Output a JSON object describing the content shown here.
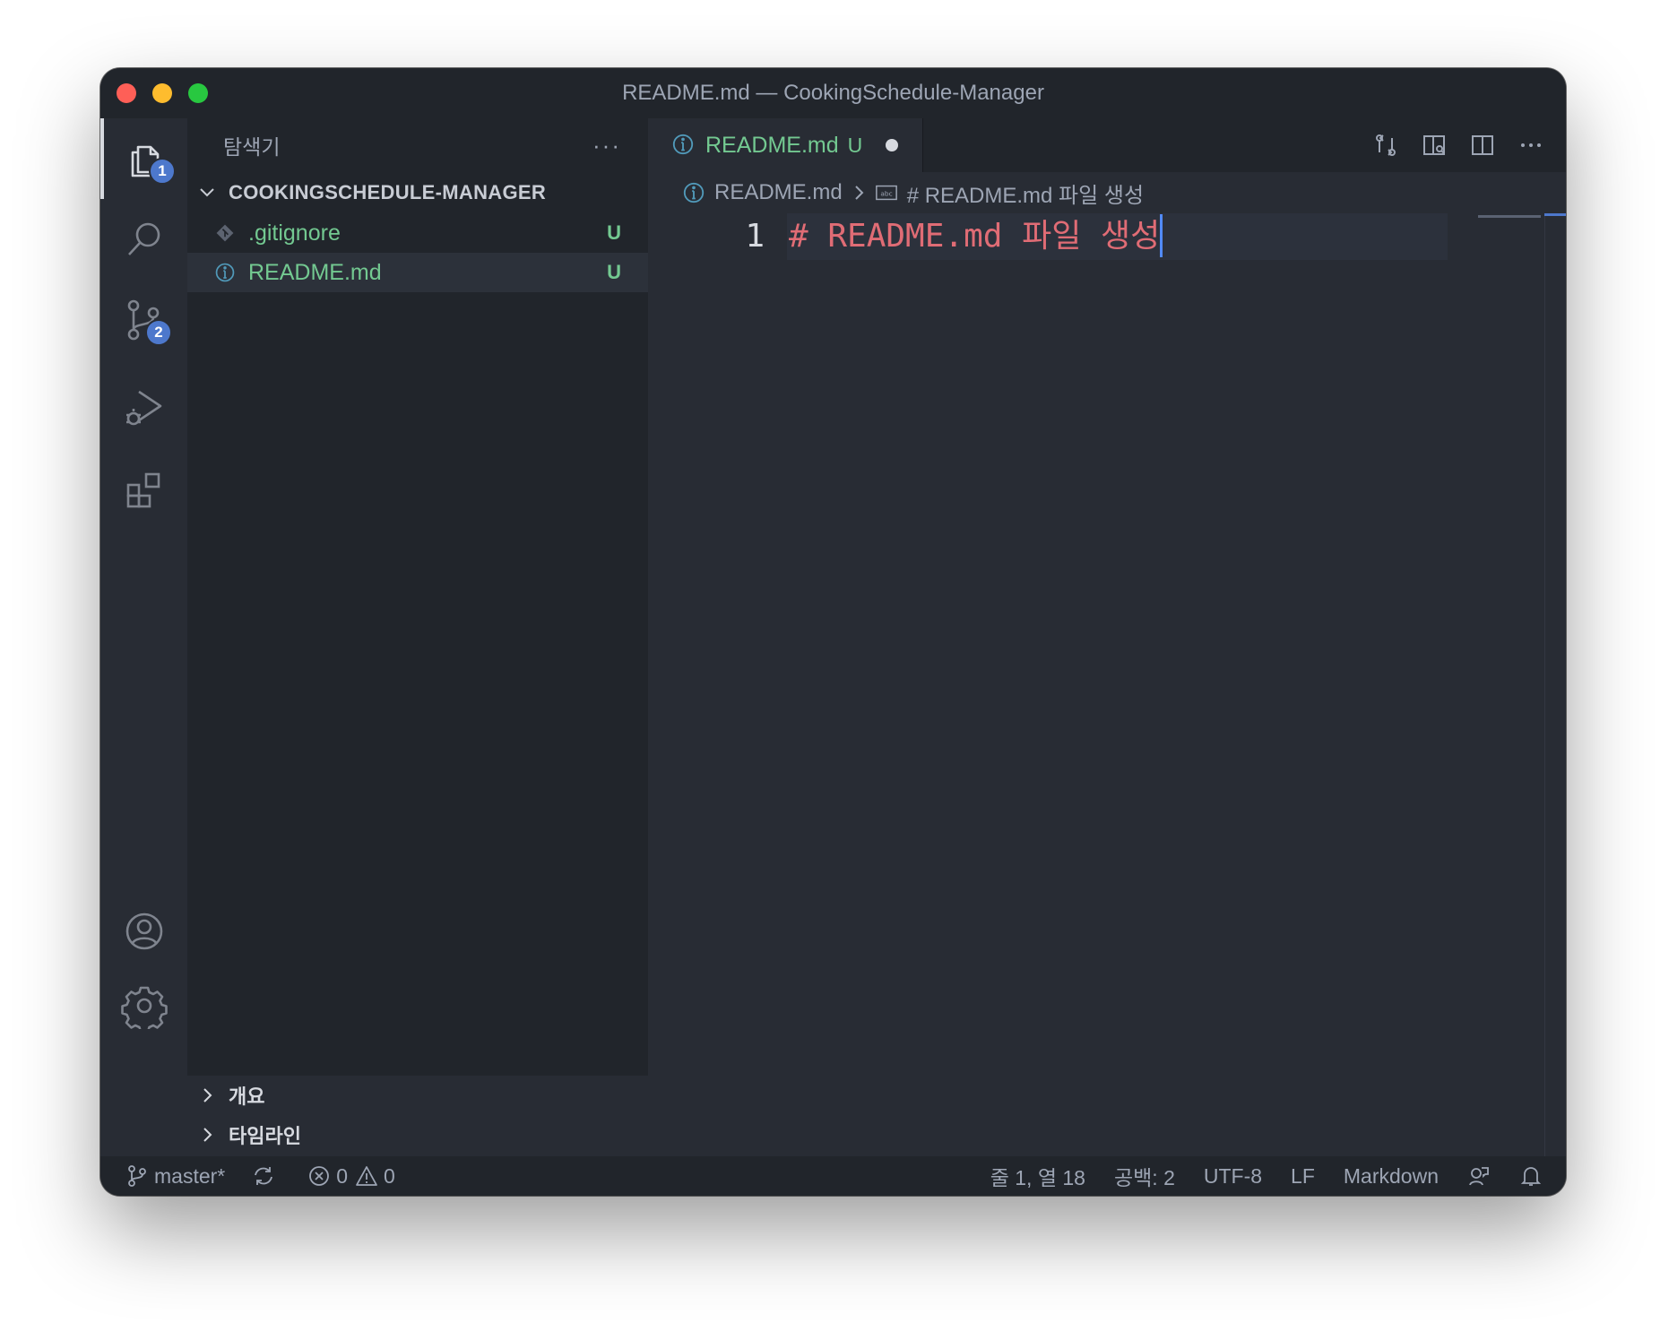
{
  "window": {
    "title": "README.md — CookingSchedule-Manager"
  },
  "activity_bar": {
    "explorer_badge": "1",
    "source_control_badge": "2"
  },
  "sidebar": {
    "header": "탐색기",
    "more": "···",
    "folder_name": "COOKINGSCHEDULE-MANAGER",
    "files": [
      {
        "name": ".gitignore",
        "status": "U",
        "icon": "git-diamond-icon"
      },
      {
        "name": "README.md",
        "status": "U",
        "icon": "info-icon"
      }
    ],
    "panels": [
      {
        "label": "개요"
      },
      {
        "label": "타임라인"
      }
    ]
  },
  "editor": {
    "tab": {
      "label": "README.md",
      "status": "U"
    },
    "breadcrumb": {
      "file": "README.md",
      "symbol": "# README.md 파일 생성"
    },
    "lines": [
      {
        "number": "1",
        "text": "# README.md 파일 생성"
      }
    ]
  },
  "statusbar": {
    "branch": "master*",
    "errors": "0",
    "warnings": "0",
    "position": "줄 1, 열 18",
    "indent": "공백: 2",
    "encoding": "UTF-8",
    "eol": "LF",
    "language": "Markdown"
  },
  "colors": {
    "accent": "#4d78cc",
    "untracked": "#73c991",
    "heading": "#e06c75",
    "background": "#282c34"
  }
}
